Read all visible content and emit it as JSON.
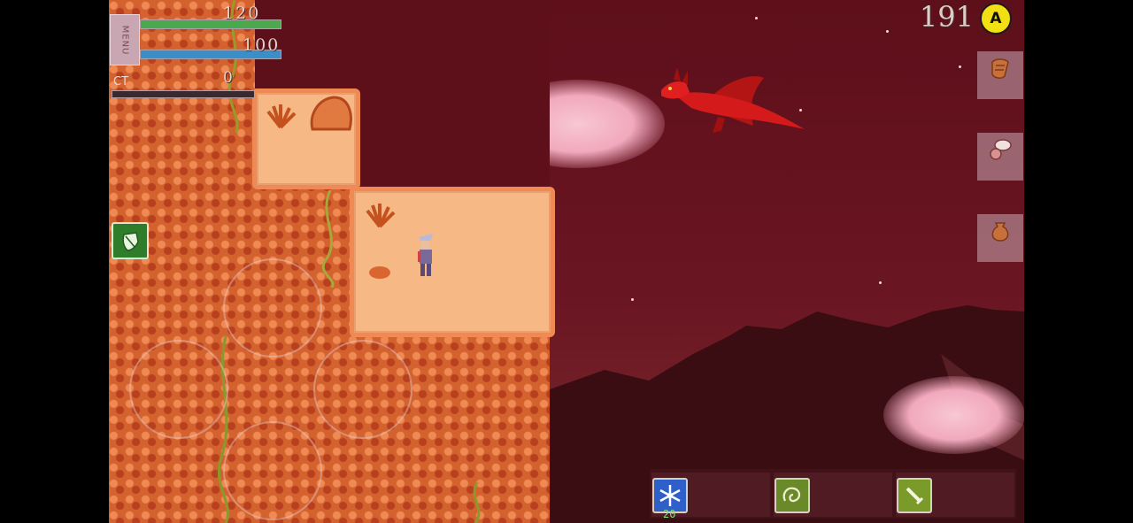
{
  "hud": {
    "menu_label": "MENU",
    "hp_value": "120",
    "mp_value": "100",
    "ct_label": "CT",
    "ct_value": "0",
    "hp_color": "#4aa84f",
    "mp_color": "#3a8fc8"
  },
  "currency": {
    "amount": "191",
    "badge_letter": "A"
  },
  "side_slots": [
    {
      "icon": "scroll-icon"
    },
    {
      "icon": "speech-bubble-icon"
    },
    {
      "icon": "bag-icon"
    }
  ],
  "skills": [
    {
      "icon": "snowflake-icon",
      "count": "20"
    },
    {
      "icon": "whirlwind-icon",
      "count": ""
    },
    {
      "icon": "sword-icon",
      "count": ""
    }
  ],
  "colors": {
    "sky": "#5d0f1a",
    "cliff": "#d4622f",
    "plateau": "#f6b986",
    "dragon": "#d41a1a"
  }
}
